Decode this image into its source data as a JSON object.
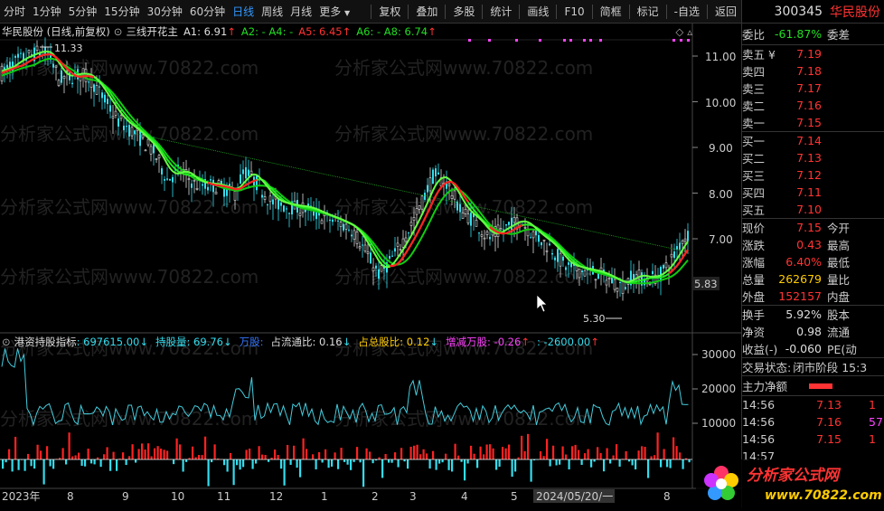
{
  "toolbar": {
    "periods": [
      "分时",
      "1分钟",
      "5分钟",
      "15分钟",
      "30分钟",
      "60分钟",
      "日线",
      "周线",
      "月线",
      "更多"
    ],
    "active_period": "日线",
    "buttons": [
      "复权",
      "叠加",
      "多股",
      "统计",
      "画线",
      "F10",
      "简框",
      "标记",
      "-自选",
      "返回"
    ]
  },
  "stock": {
    "code": "300345",
    "name": "华民股份"
  },
  "kline_header": {
    "title": "华民股份 (日线,前复权)",
    "indicator_name": "三线开花主",
    "a1": "A1: 6.91",
    "a2": "A2: - A4: -",
    "a5": "A5: 6.45",
    "a6": "A6: - A8: 6.74"
  },
  "price_axis": {
    "ticks": [
      "11.00",
      "10.00",
      "9.00",
      "8.00",
      "7.00"
    ],
    "current_label": "5.83"
  },
  "annotations": {
    "high": "11.33",
    "low": "5.30"
  },
  "ind_header": {
    "name": "港资持股指标",
    "v1": ": 697615.00",
    "v2": "持股量: 69.76",
    "v3": "万股:",
    "v4": "占流通比: 0.16",
    "v5": "占总股比: 0.12",
    "v6": "增减万股: -0.26",
    "v7": ": -2600.00"
  },
  "ind_axis": {
    "ticks": [
      "30000",
      "20000",
      "10000"
    ]
  },
  "date_axis": {
    "labels": [
      "2023年",
      "8",
      "9",
      "10",
      "11",
      "12",
      "1",
      "2",
      "3",
      "4",
      "5",
      "2024/05/20/一",
      "8"
    ]
  },
  "order_book": {
    "weibi_label": "委比",
    "weibi_value": "-61.87%",
    "weicha_label": "委差",
    "sells": [
      {
        "label": "卖五 ¥",
        "price": "7.19"
      },
      {
        "label": "卖四",
        "price": "7.18"
      },
      {
        "label": "卖三",
        "price": "7.17"
      },
      {
        "label": "卖二",
        "price": "7.16"
      },
      {
        "label": "卖一",
        "price": "7.15"
      }
    ],
    "buys": [
      {
        "label": "买一",
        "price": "7.14"
      },
      {
        "label": "买二",
        "price": "7.13"
      },
      {
        "label": "买三",
        "price": "7.12"
      },
      {
        "label": "买四",
        "price": "7.11"
      },
      {
        "label": "买五",
        "price": "7.10"
      }
    ]
  },
  "quote": [
    {
      "label": "现价",
      "value": "7.15",
      "right": "今开",
      "color": "red"
    },
    {
      "label": "涨跌",
      "value": "0.43",
      "right": "最高",
      "color": "red"
    },
    {
      "label": "涨幅",
      "value": "6.40%",
      "right": "最低",
      "color": "red"
    },
    {
      "label": "总量",
      "value": "262679",
      "right": "量比",
      "color": "yellow"
    },
    {
      "label": "外盘",
      "value": "152157",
      "right": "内盘",
      "color": "red"
    }
  ],
  "stats": [
    {
      "label": "换手",
      "value": "5.92%",
      "right": "股本"
    },
    {
      "label": "净资",
      "value": "0.98",
      "right": "流通"
    },
    {
      "label": "收益(-)",
      "value": "-0.060",
      "right": "PE(动"
    }
  ],
  "trade_status": {
    "label": "交易状态:",
    "value": "闭市阶段 15:3"
  },
  "main_flow": {
    "label": "主力净额"
  },
  "ticks": [
    {
      "time": "14:56",
      "price": "7.13",
      "vol": "1"
    },
    {
      "time": "14:56",
      "price": "7.16",
      "vol": "57"
    },
    {
      "time": "14:56",
      "price": "7.15",
      "vol": "1"
    },
    {
      "time": "14:57",
      "price": "",
      "vol": ""
    }
  ],
  "watermark": {
    "brand": "分析家公式网",
    "url": "www.70822.com",
    "bg_text": "分析家公式网www.70822.com"
  },
  "colors": {
    "up": "#ff3333",
    "down": "#33ddee",
    "ma_green": "#22ee22",
    "accent": "#3399ff"
  }
}
